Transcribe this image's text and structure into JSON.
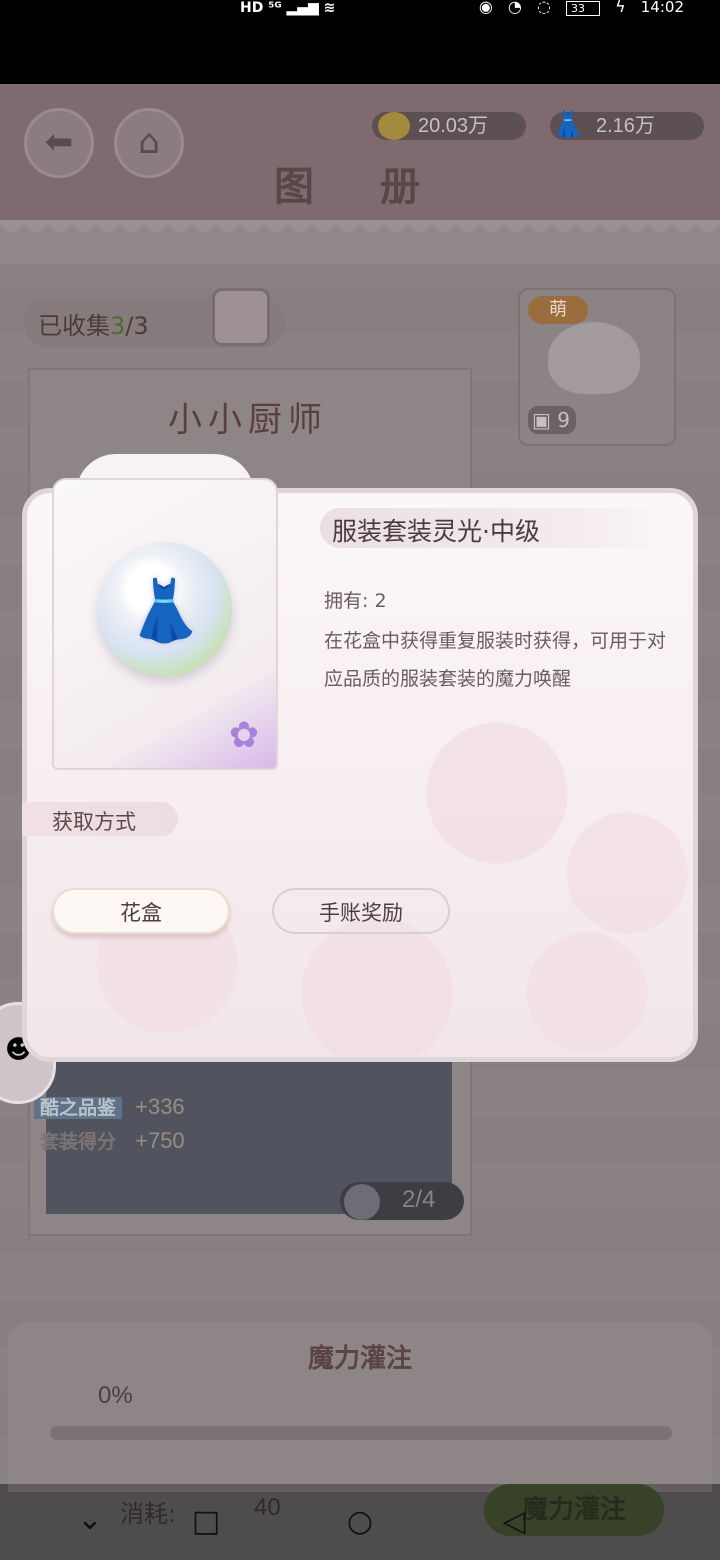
{
  "status_bar": {
    "network": "HD ⁵ᴳ",
    "right_icons": [
      "eye-icon",
      "alarm-icon",
      "nfc-icon",
      "battery-icon",
      "charging-icon"
    ],
    "battery": "33",
    "time": "14:02"
  },
  "header": {
    "title": "图 册",
    "coins": "20.03万",
    "dress_points": "2.16万"
  },
  "collection": {
    "label_prefix": "已收集",
    "collected": "3",
    "total": "/3"
  },
  "side_card": {
    "tag": "萌",
    "count": "9"
  },
  "suit": {
    "name": "小小厨师",
    "stat1_label": "酷之品鉴",
    "stat1_value": "+336",
    "stat2_label": "套装得分",
    "stat2_value": "+750",
    "progress": "2/4"
  },
  "bottom": {
    "title": "魔力灌注",
    "percent": "0%",
    "progress_fraction": 0,
    "consume_label": "消耗:",
    "consume_value": "40",
    "button_label": "魔力灌注"
  },
  "dialog": {
    "item_name": "服装套装灵光·中级",
    "own_text": "拥有: 2",
    "description": "在花盒中获得重复服装时获得，可用于对应品质的服装套装的魔力唤醒",
    "acquire_label": "获取方式",
    "sources": [
      "花盒",
      "手账奖励"
    ]
  },
  "colors": {
    "dialog_bg": "#f6eeef",
    "accent_purple": "#a882d8",
    "text_dark": "#4a3b3d"
  }
}
